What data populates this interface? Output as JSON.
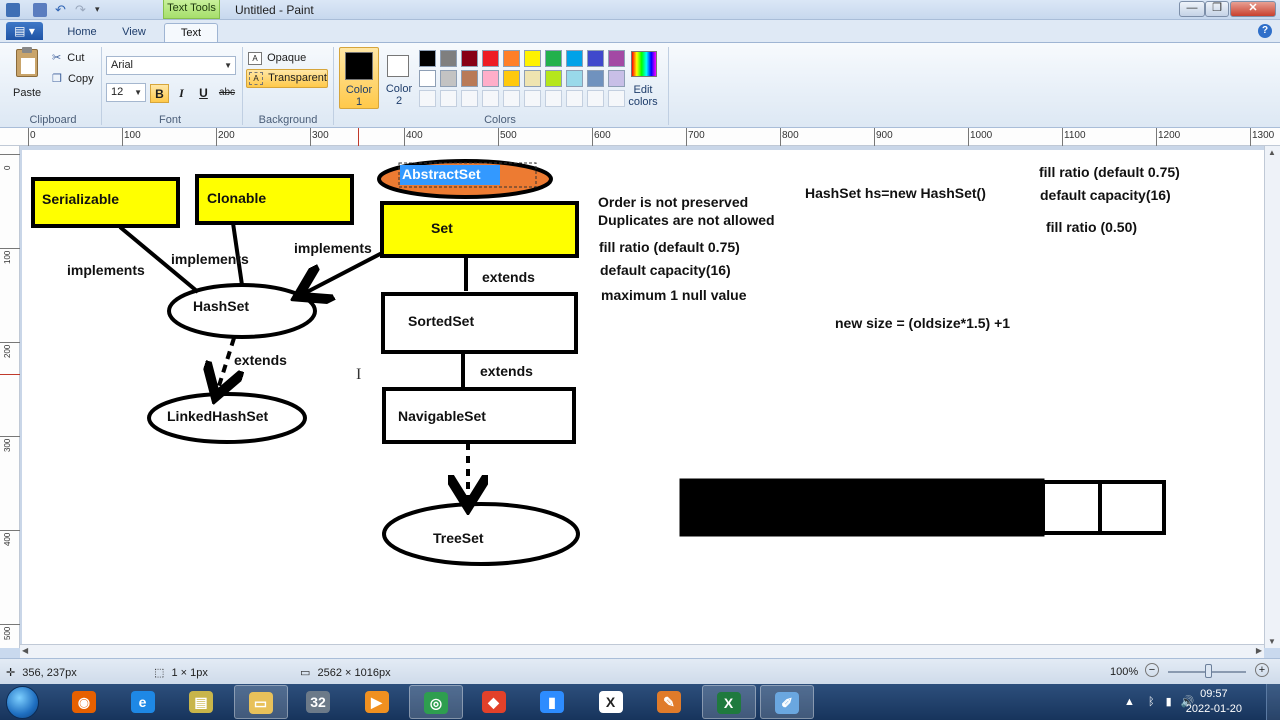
{
  "window": {
    "title": "Untitled - Paint",
    "contextual_tab": "Text Tools"
  },
  "tabs": [
    {
      "label": "Home"
    },
    {
      "label": "View"
    },
    {
      "label": "Text"
    }
  ],
  "ribbon": {
    "clipboard": {
      "paste_label": "Paste",
      "cut_label": "Cut",
      "copy_label": "Copy",
      "group_label": "Clipboard"
    },
    "font": {
      "family": "Arial",
      "size": "12",
      "bold_label": "B",
      "italic_label": "I",
      "underline_label": "U",
      "strike_label": "abc",
      "group_label": "Font",
      "bold_active": true
    },
    "background": {
      "opaque_label": "Opaque",
      "transparent_label": "Transparent",
      "group_label": "Background",
      "selected": "Transparent"
    },
    "colors": {
      "color1_label": "Color\n1",
      "color1_line1": "Color",
      "color1_line2": "1",
      "color2_line1": "Color",
      "color2_line2": "2",
      "color1_value": "#000000",
      "color2_value": "#ffffff",
      "edit_line1": "Edit",
      "edit_line2": "colors",
      "group_label": "Colors",
      "palette_row1": [
        "#000000",
        "#7f7f7f",
        "#880015",
        "#ed1c24",
        "#ff7f27",
        "#fff200",
        "#22b14c",
        "#00a2e8",
        "#3f48cc",
        "#a349a4"
      ],
      "palette_row2": [
        "#ffffff",
        "#c3c3c3",
        "#b97a57",
        "#ffaec9",
        "#ffc90e",
        "#efe4b0",
        "#b5e61d",
        "#99d9ea",
        "#7092be",
        "#c8bfe7"
      ],
      "palette_row3_count_empty": true
    }
  },
  "ruler": {
    "top_labels": [
      "0",
      "100",
      "200",
      "300",
      "400",
      "500",
      "600",
      "700",
      "800",
      "900",
      "1000",
      "1100",
      "1200",
      "1300"
    ],
    "left_labels": [
      "0",
      "100",
      "200",
      "300",
      "400",
      "500"
    ]
  },
  "canvas": {
    "selected_text": "AbstractSet",
    "boxes": {
      "serializable": "Serializable",
      "clonable": "Clonable",
      "set": "Set",
      "sorted_set": "SortedSet",
      "navigable_set": "NavigableSet"
    },
    "ellipses": {
      "abstract_set": "AbstractSet",
      "hash_set": "HashSet",
      "linked_hash_set": "LinkedHashSet",
      "tree_set": "TreeSet"
    },
    "labels": {
      "implements_1": "implements",
      "implements_2": "implements",
      "implements_3": "implements",
      "extends_1": "extends",
      "extends_2": "extends",
      "extends_3": "extends"
    },
    "notes": {
      "order": "Order is not preserved",
      "duplicates": "Duplicates are not allowed",
      "fill_ratio_1": "fill ratio (default 0.75)",
      "default_capacity_1": "default capacity(16)",
      "max_null": "maximum 1 null value",
      "hashset_decl": "HashSet hs=new HashSet()",
      "fill_ratio_2": "fill ratio (default 0.75)",
      "default_capacity_2": "default capacity(16)",
      "fill_ratio_3": "fill ratio (0.50)",
      "new_size": "new size = (oldsize*1.5) +1"
    }
  },
  "status": {
    "cursor_pos": "356, 237px",
    "selection_size": "1 × 1px",
    "image_size": "2562 × 1016px",
    "zoom": "100%"
  },
  "taskbar": {
    "apps": [
      {
        "name": "firefox",
        "open": false,
        "color": "#e66000",
        "glyph": "◉"
      },
      {
        "name": "internet-explorer",
        "open": false,
        "color": "#1e88e5",
        "glyph": "e"
      },
      {
        "name": "notes",
        "open": false,
        "color": "#c8b54a",
        "glyph": "▤"
      },
      {
        "name": "explorer",
        "open": true,
        "color": "#e8c15a",
        "glyph": "▭"
      },
      {
        "name": "calendar",
        "open": false,
        "color": "#6c7a89",
        "glyph": "32"
      },
      {
        "name": "media",
        "open": false,
        "color": "#f09020",
        "glyph": "▶"
      },
      {
        "name": "chrome",
        "open": true,
        "color": "#2e9e4f",
        "glyph": "◎"
      },
      {
        "name": "anydesk",
        "open": false,
        "color": "#e2412a",
        "glyph": "◆"
      },
      {
        "name": "zoom",
        "open": false,
        "color": "#2d8cff",
        "glyph": "▮"
      },
      {
        "name": "xming",
        "open": false,
        "color": "#ffffff",
        "glyph": "X"
      },
      {
        "name": "tool",
        "open": false,
        "color": "#e07b2a",
        "glyph": "✎"
      },
      {
        "name": "excel",
        "open": true,
        "color": "#1f7a3e",
        "glyph": "X"
      },
      {
        "name": "paint",
        "open": true,
        "color": "#6aa7e0",
        "glyph": "✐"
      }
    ],
    "time": "09:57",
    "date": "2022-01-20"
  }
}
